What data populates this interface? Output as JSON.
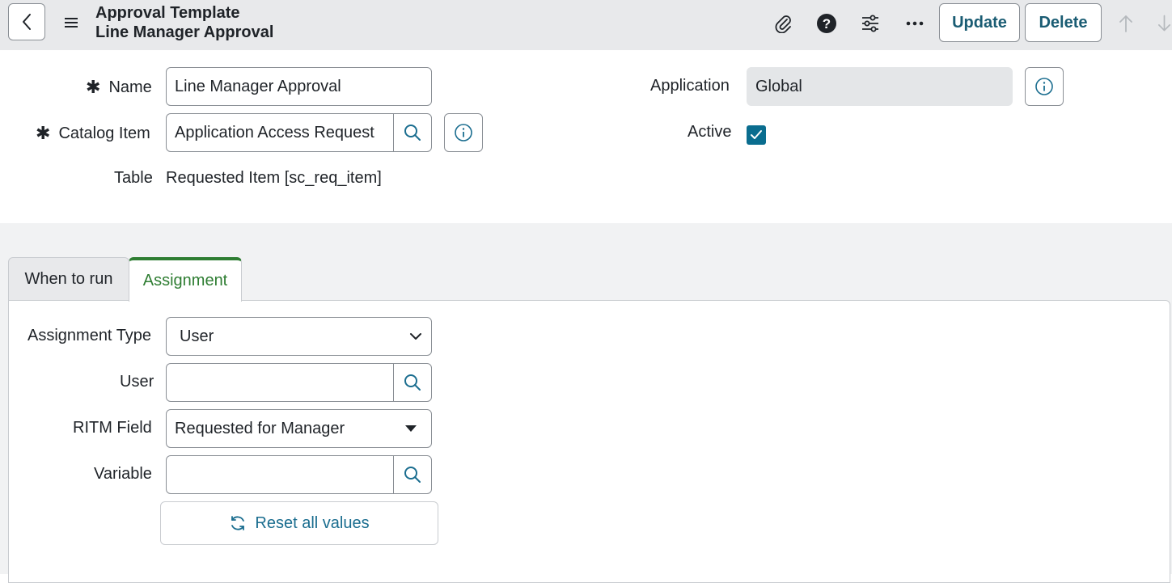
{
  "header": {
    "title_line1": "Approval Template",
    "title_line2": "Line Manager Approval",
    "update_label": "Update",
    "delete_label": "Delete",
    "icons": [
      "back-icon",
      "hamburger-menu-icon",
      "paperclip-icon",
      "help-icon",
      "settings-sliders-icon",
      "more-options-icon",
      "arrow-up-icon",
      "arrow-down-icon"
    ]
  },
  "form": {
    "name_label": "Name",
    "name_value": "Line Manager Approval",
    "catalog_item_label": "Catalog Item",
    "catalog_item_value": "Application Access Request",
    "table_label": "Table",
    "table_value": "Requested Item [sc_req_item]",
    "application_label": "Application",
    "application_value": "Global",
    "active_label": "Active",
    "active_checked": true,
    "required_marker": "✱"
  },
  "tabs": [
    {
      "label": "When to run",
      "active": false
    },
    {
      "label": "Assignment",
      "active": true
    }
  ],
  "assignment": {
    "type_label": "Assignment Type",
    "type_value": "User",
    "user_label": "User",
    "user_value": "",
    "ritm_label": "RITM Field",
    "ritm_value": "Requested for Manager",
    "variable_label": "Variable",
    "variable_value": "",
    "reset_label": "Reset all values"
  },
  "colors": {
    "accent": "#0a6d8f",
    "tab_active": "#2e7d32",
    "header_bg": "#e8e9eb",
    "button_text": "#1a5c73"
  }
}
